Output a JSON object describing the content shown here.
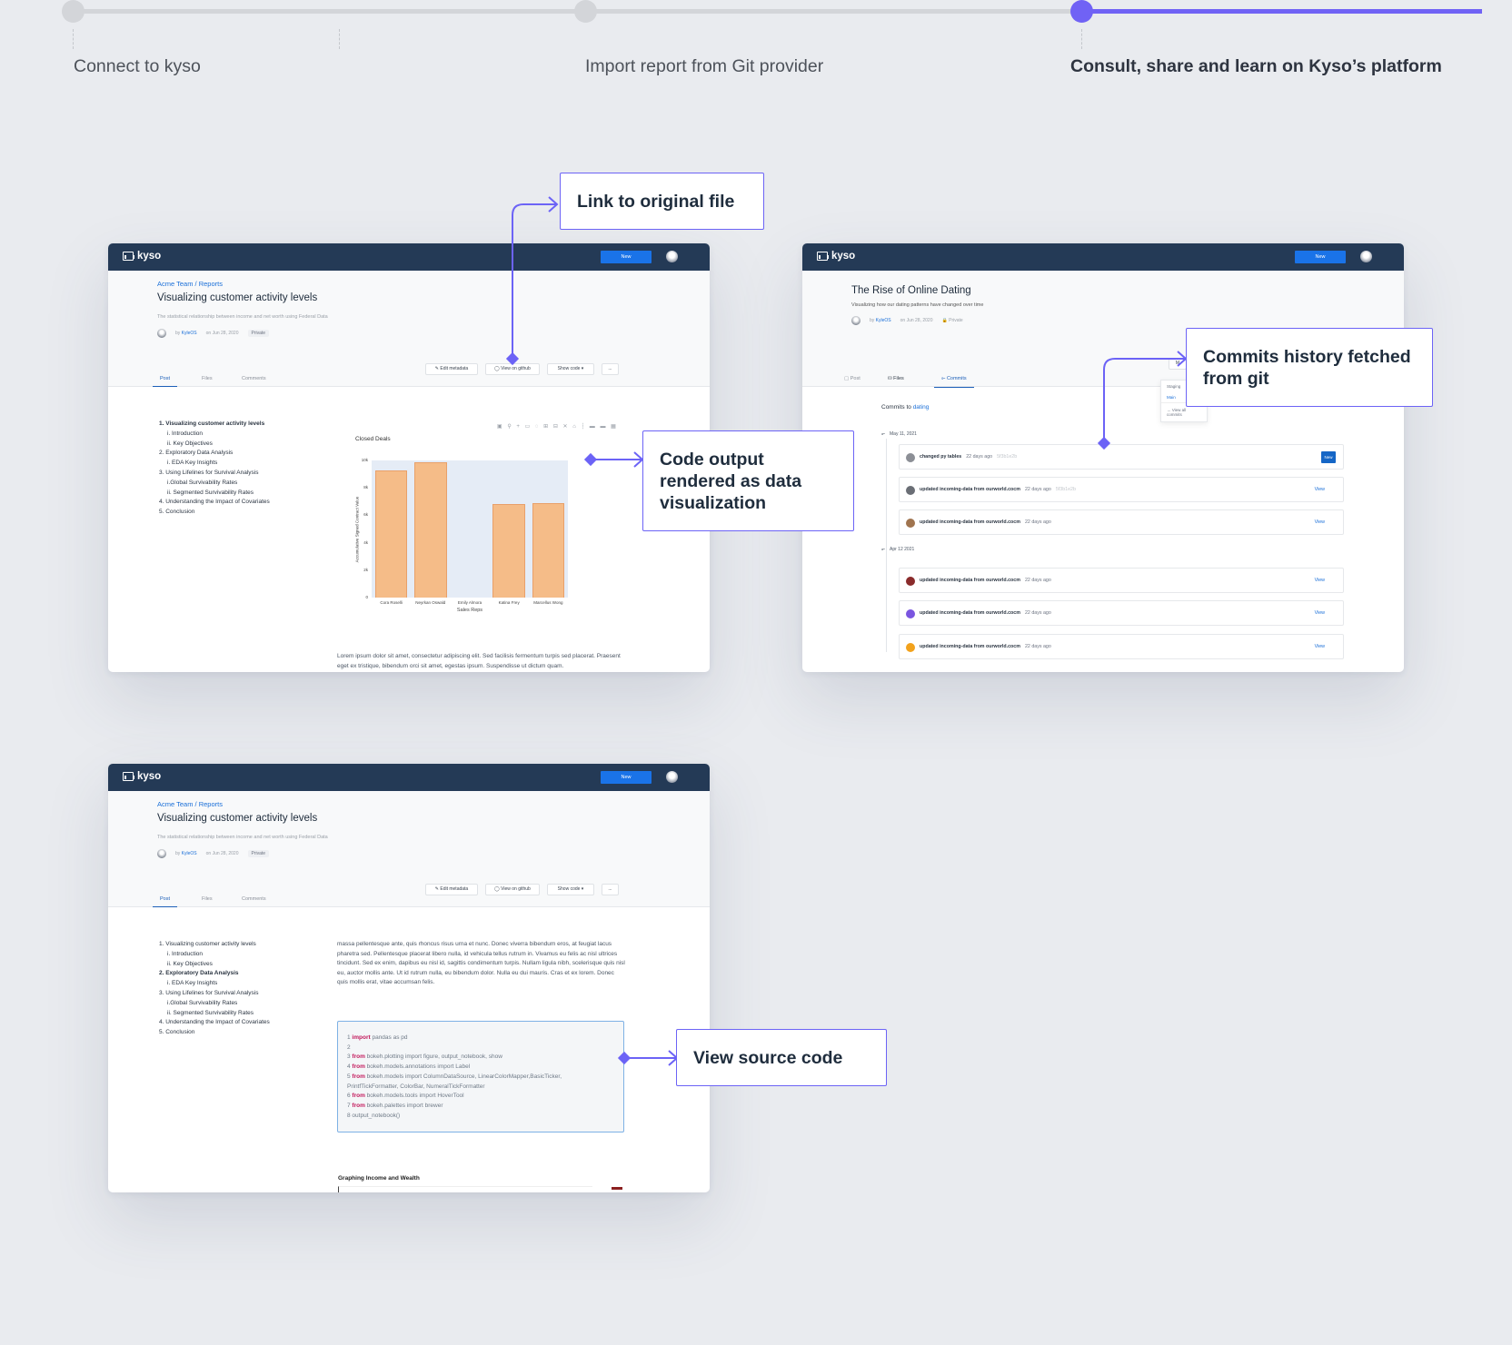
{
  "stepper": {
    "steps": [
      {
        "label": "Connect to kyso"
      },
      {
        "label": "Import report from Git provider"
      },
      {
        "label": "Consult, share and learn on Kyso’s platform"
      }
    ]
  },
  "callouts": {
    "link_original": "Link to original file",
    "code_output": "Code output rendered as data visualization",
    "commits_history": "Commits history fetched from git",
    "view_source": "View source code"
  },
  "app": {
    "brand": "kyso",
    "new_button": "New"
  },
  "report": {
    "breadcrumb": "Acme Team / Reports",
    "title": "Visualizing customer activity levels",
    "subtitle": "The statistical relationship between income and net worth using Federal Data",
    "author_prefix": "by",
    "author": "KyleOS",
    "date": "on Jun 28, 2020",
    "visibility": "Private",
    "tabs": [
      "Post",
      "Files",
      "Comments"
    ],
    "actions": {
      "edit_metadata": "✎ Edit metadata",
      "view_on_github": "◯ View on github",
      "show_code": "Show code ▾",
      "more": "..."
    },
    "toc": [
      {
        "text": "1. Visualizing customer activity levels",
        "level": 1
      },
      {
        "text": "i. Introduction",
        "level": 2
      },
      {
        "text": "ii. Key Objectives",
        "level": 2
      },
      {
        "text": "2. Exploratory Data Analysis",
        "level": 1
      },
      {
        "text": "i. EDA Key Insights",
        "level": 2
      },
      {
        "text": "3. Using Lifelines for Survival Analysis",
        "level": 1
      },
      {
        "text": "i.Global Survivability Rates",
        "level": 2
      },
      {
        "text": "ii. Segmented Survivability Rates",
        "level": 2
      },
      {
        "text": "4. Understanding the Impact of Covariates",
        "level": 1
      },
      {
        "text": "5. Conclusion",
        "level": 1
      }
    ],
    "lorem": "Lorem ipsum dolor sit amet, consectetur adipiscing elit. Sed facilisis fermentum turpis sed placerat. Praesent eget ex tristique, bibendum orci sit amet, egestas ipsum. Suspendisse ut dictum quam.",
    "massa": "massa pellentesque ante, quis rhoncus risus urna et nunc. Donec viverra bibendum eros, at feugiat lacus pharetra sed. Pellentesque placerat libero nulla, id vehicula tellus rutrum in. Vivamus eu felis ac nisl ultrices tincidunt. Sed ex enim, dapibus eu nisl id, sagittis condimentum turpis. Nullam ligula nibh, scelerisque quis nisl eu, auctor mollis ante. Ut id rutrum nulla, eu bibendum dolor. Nulla eu dui mauris. Cras et ex lorem. Donec quis mollis erat, vitae accumsan felis.",
    "code_lines": [
      {
        "n": "1",
        "kw": "import",
        "rest": " pandas as pd"
      },
      {
        "n": "2",
        "kw": "",
        "rest": ""
      },
      {
        "n": "3",
        "kw": "from",
        "rest": " bokeh.plotting import figure, output_notebook, show"
      },
      {
        "n": "4",
        "kw": "from",
        "rest": " bokeh.models.annotations import Label"
      },
      {
        "n": "5",
        "kw": "from",
        "rest": " bokeh.models import ColumnDataSource, LinearColorMapper,BasicTicker,"
      },
      {
        "n": "",
        "kw": "",
        "rest": "PrintfTickFormatter, ColorBar, NumeralTickFormatter"
      },
      {
        "n": "6",
        "kw": "from",
        "rest": " bokeh.models.tools import HoverTool"
      },
      {
        "n": "7",
        "kw": "from",
        "rest": " bokeh.palettes import brewer"
      },
      {
        "n": "8",
        "kw": "",
        "rest": " output_notebook()"
      }
    ],
    "graph_heading": "Graphing Income and Wealth"
  },
  "chart_data": {
    "type": "bar",
    "title": "Closed Deals",
    "xlabel": "Sales Reps",
    "ylabel": "Accumulative Signed Contract Value",
    "categories": [
      "Cora Roselli",
      "Neyrkan Oswald",
      "Emily Almora",
      "Katina Frey",
      "Marcellus Wong"
    ],
    "values": [
      9.3,
      9.9,
      0,
      6.8,
      6.9
    ],
    "ylim": [
      0,
      10
    ],
    "yticks": [
      "0",
      "2k",
      "4k",
      "6k",
      "8k",
      "10k"
    ],
    "color": "#f5bc88"
  },
  "dating": {
    "title": "The Rise of Online Dating",
    "subtitle": "Visualizing how our dating patterns have changed over time",
    "author_prefix": "by",
    "author": "KyleOS",
    "date": "on Jun 28, 2020",
    "visibility": "🔒 Private",
    "tabs": [
      "Post",
      "Files",
      "Commits"
    ],
    "commits_to_label": "Commits to",
    "commits_to_repo": "dating",
    "dropdown": {
      "header": "Staging",
      "item": "Main",
      "footer": "→ View all commits",
      "button": "M"
    },
    "groups": [
      {
        "date": "May 11, 2021",
        "commits": [
          {
            "msg": "changed py tables",
            "ago": "22 days ago",
            "hash": "5f3b1e2b",
            "action": "New",
            "avatar": "#8c8f96"
          },
          {
            "msg": "updated incoming-data from ourworld.cocm",
            "ago": "22 days ago",
            "hash": "5f3b1e2b",
            "action": "View",
            "avatar": "#6a6e75"
          },
          {
            "msg": "updated incoming-data from ourworld.cocm",
            "ago": "22 days ago",
            "hash": "",
            "action": "View",
            "avatar": "#a0744f"
          }
        ]
      },
      {
        "date": "Apr 12 2021",
        "commits": [
          {
            "msg": "updated incoming-data from ourworld.cocm",
            "ago": "22 days ago",
            "hash": "",
            "action": "View",
            "avatar": "#8a2b2b"
          },
          {
            "msg": "updated incoming-data from ourworld.cocm",
            "ago": "22 days ago",
            "hash": "",
            "action": "View",
            "avatar": "#7a55e0"
          },
          {
            "msg": "updated incoming-data from ourworld.cocm",
            "ago": "22 days ago",
            "hash": "",
            "action": "View",
            "avatar": "#f2a21c"
          }
        ]
      }
    ]
  },
  "colors": {
    "accent": "#7062f5",
    "navbar": "#243a56",
    "link": "#1a6fd8",
    "bar": "#f5bc88"
  }
}
